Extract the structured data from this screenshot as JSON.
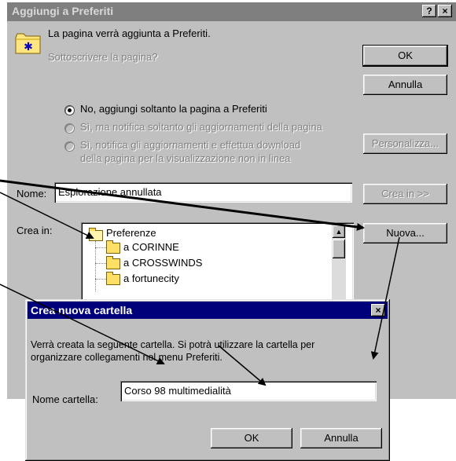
{
  "main_dialog": {
    "title": "Aggiungi a Preferiti",
    "help_button": "?",
    "close_button": "×",
    "message": "La pagina verrà aggiunta a Preferiti.",
    "subscribe_question": "Sottoscrivere la pagina?",
    "options": [
      {
        "label": "No, aggiungi soltanto la pagina a Preferiti",
        "checked": true,
        "enabled": true
      },
      {
        "label": "Sì, ma notifica soltanto gli aggiornamenti della pagina",
        "checked": false,
        "enabled": false
      },
      {
        "label_line1": "Sì, notifica gli aggiornamenti e effettua download",
        "label_line2": "della pagina per la visualizzazione non in linea",
        "checked": false,
        "enabled": false
      }
    ],
    "ok_label": "OK",
    "cancel_label": "Annulla",
    "customize_label": "Personalizza...",
    "name_label": "Nome:",
    "name_value": "Esplorazione annullata",
    "create_in_expand_label": "Crea in >>",
    "create_in_label": "Crea in:",
    "new_folder_label": "Nuova...",
    "folder_tree": {
      "root": "Preferenze",
      "children": [
        "a CORINNE",
        "a CROSSWINDS",
        "a fortunecity"
      ]
    }
  },
  "new_folder_dialog": {
    "title": "Crea nuova cartella",
    "close_button": "×",
    "message_line1": "Verrà creata la seguente cartella. Si potrà utilizzare la cartella per",
    "message_line2": "organizzare collegamenti nel menu Preferiti.",
    "folder_name_label": "Nome cartella:",
    "folder_name_value": "Corso 98 multimedialità",
    "ok_label": "OK",
    "cancel_label": "Annulla"
  },
  "colors": {
    "inactive_title": "#7f7f7f",
    "active_title": "#00007b",
    "face": "#c0c0c0",
    "arrows": "#000000"
  }
}
